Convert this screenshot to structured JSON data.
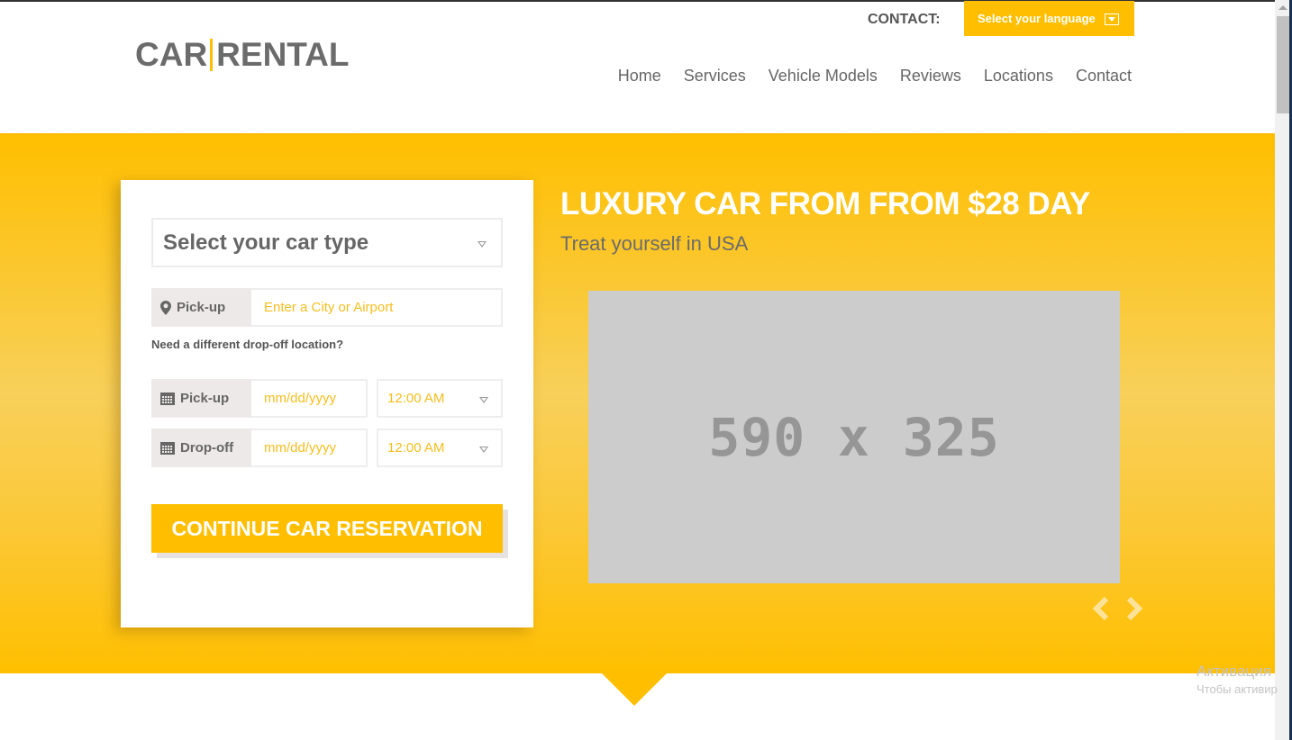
{
  "header": {
    "logo_left": "CAR",
    "logo_right": "RENTAL",
    "contact_label": "CONTACT:",
    "language_button": "Select your language",
    "nav": [
      {
        "label": "Home"
      },
      {
        "label": "Services"
      },
      {
        "label": "Vehicle Models"
      },
      {
        "label": "Reviews"
      },
      {
        "label": "Locations"
      },
      {
        "label": "Contact"
      }
    ]
  },
  "form": {
    "car_type_select": "Select your car type",
    "pickup_location": {
      "label": "Pick-up",
      "placeholder": "Enter a City or Airport",
      "icon": "map-marker-icon"
    },
    "dropoff_link": "Need a different drop-off location?",
    "pickup_date": {
      "label": "Pick-up",
      "placeholder": "mm/dd/yyyy",
      "time": "12:00 AM",
      "icon": "calendar-icon"
    },
    "dropoff_date": {
      "label": "Drop-off",
      "placeholder": "mm/dd/yyyy",
      "time": "12:00 AM",
      "icon": "calendar-icon"
    },
    "submit_label": "CONTINUE CAR RESERVATION"
  },
  "hero": {
    "title": "LUXURY CAR FROM FROM $28 DAY",
    "subtitle": "Treat yourself in USA",
    "image_placeholder": "590 x 325",
    "prev_icon": "chevron-left-icon",
    "next_icon": "chevron-right-icon"
  },
  "colors": {
    "accent": "#ffbf00",
    "text_gray": "#666666",
    "placeholder_gray": "#cccccc",
    "input_text": "#f7be1e"
  },
  "watermark": {
    "line1": "Активация",
    "line2": "Чтобы активир"
  }
}
